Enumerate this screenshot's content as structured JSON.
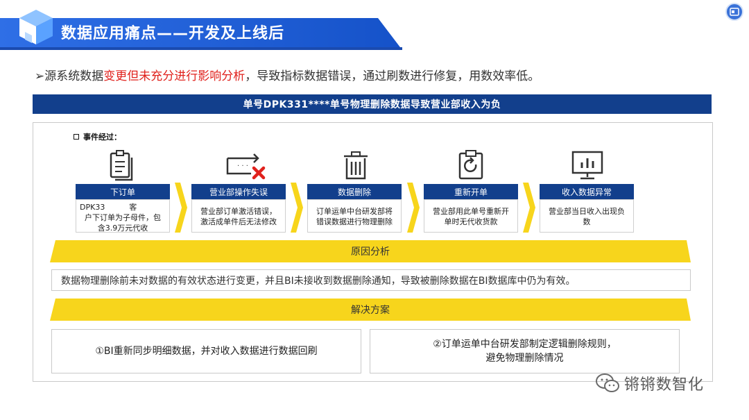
{
  "header": {
    "title": "数据应用痛点——开发及上线后"
  },
  "headline": {
    "prefix": "➢源系统数据",
    "highlight": "变更但未充分进行影响分析",
    "suffix": "，导致指标数据错误，通过刷数进行修复，用数效率低。"
  },
  "incident": {
    "title": "单号DPK331****单号物理删除数据导致营业部收入为负",
    "event_label": "事件经过：",
    "steps": [
      {
        "label": "下订单",
        "line1": "DPK33          客",
        "line2": "户下订单为子母件，包",
        "line3": "含3.9万元代收",
        "icon": "document-icon"
      },
      {
        "label": "营业部操作失误",
        "line1": "营业部订单激活错误，",
        "line2": "激活成单件后无法修改",
        "line3": "",
        "icon": "error-swap-icon"
      },
      {
        "label": "数据删除",
        "line1": "订单运单中台研发部将",
        "line2": "错误数据进行物理删除",
        "line3": "",
        "icon": "trash-icon"
      },
      {
        "label": "重新开单",
        "line1": "营业部用此单号重新开",
        "line2": "单时无代收货款",
        "line3": "",
        "icon": "refresh-clipboard-icon"
      },
      {
        "label": "收入数据异常",
        "line1": "营业部当日收入出现负",
        "line2": "数",
        "line3": "",
        "icon": "monitor-chart-icon"
      }
    ]
  },
  "cause": {
    "title": "原因分析",
    "text": "数据物理删除前未对数据的有效状态进行变更，并且BI未接收到数据删除通知，导致被删除数据在BI数据库中仍为有效。"
  },
  "solution": {
    "title": "解决方案",
    "item1": "①BI重新同步明细数据，并对收入数据进行数据回刷",
    "item2_line1": "②订单运单中台研发部制定逻辑删除规则，",
    "item2_line2": "避免物理删除情况"
  },
  "watermark": {
    "text": "锵锵数智化"
  },
  "colors": {
    "navy": "#123f8c",
    "blue": "#1f6fe0",
    "yellow": "#f7d51c",
    "red": "#e0211c"
  }
}
